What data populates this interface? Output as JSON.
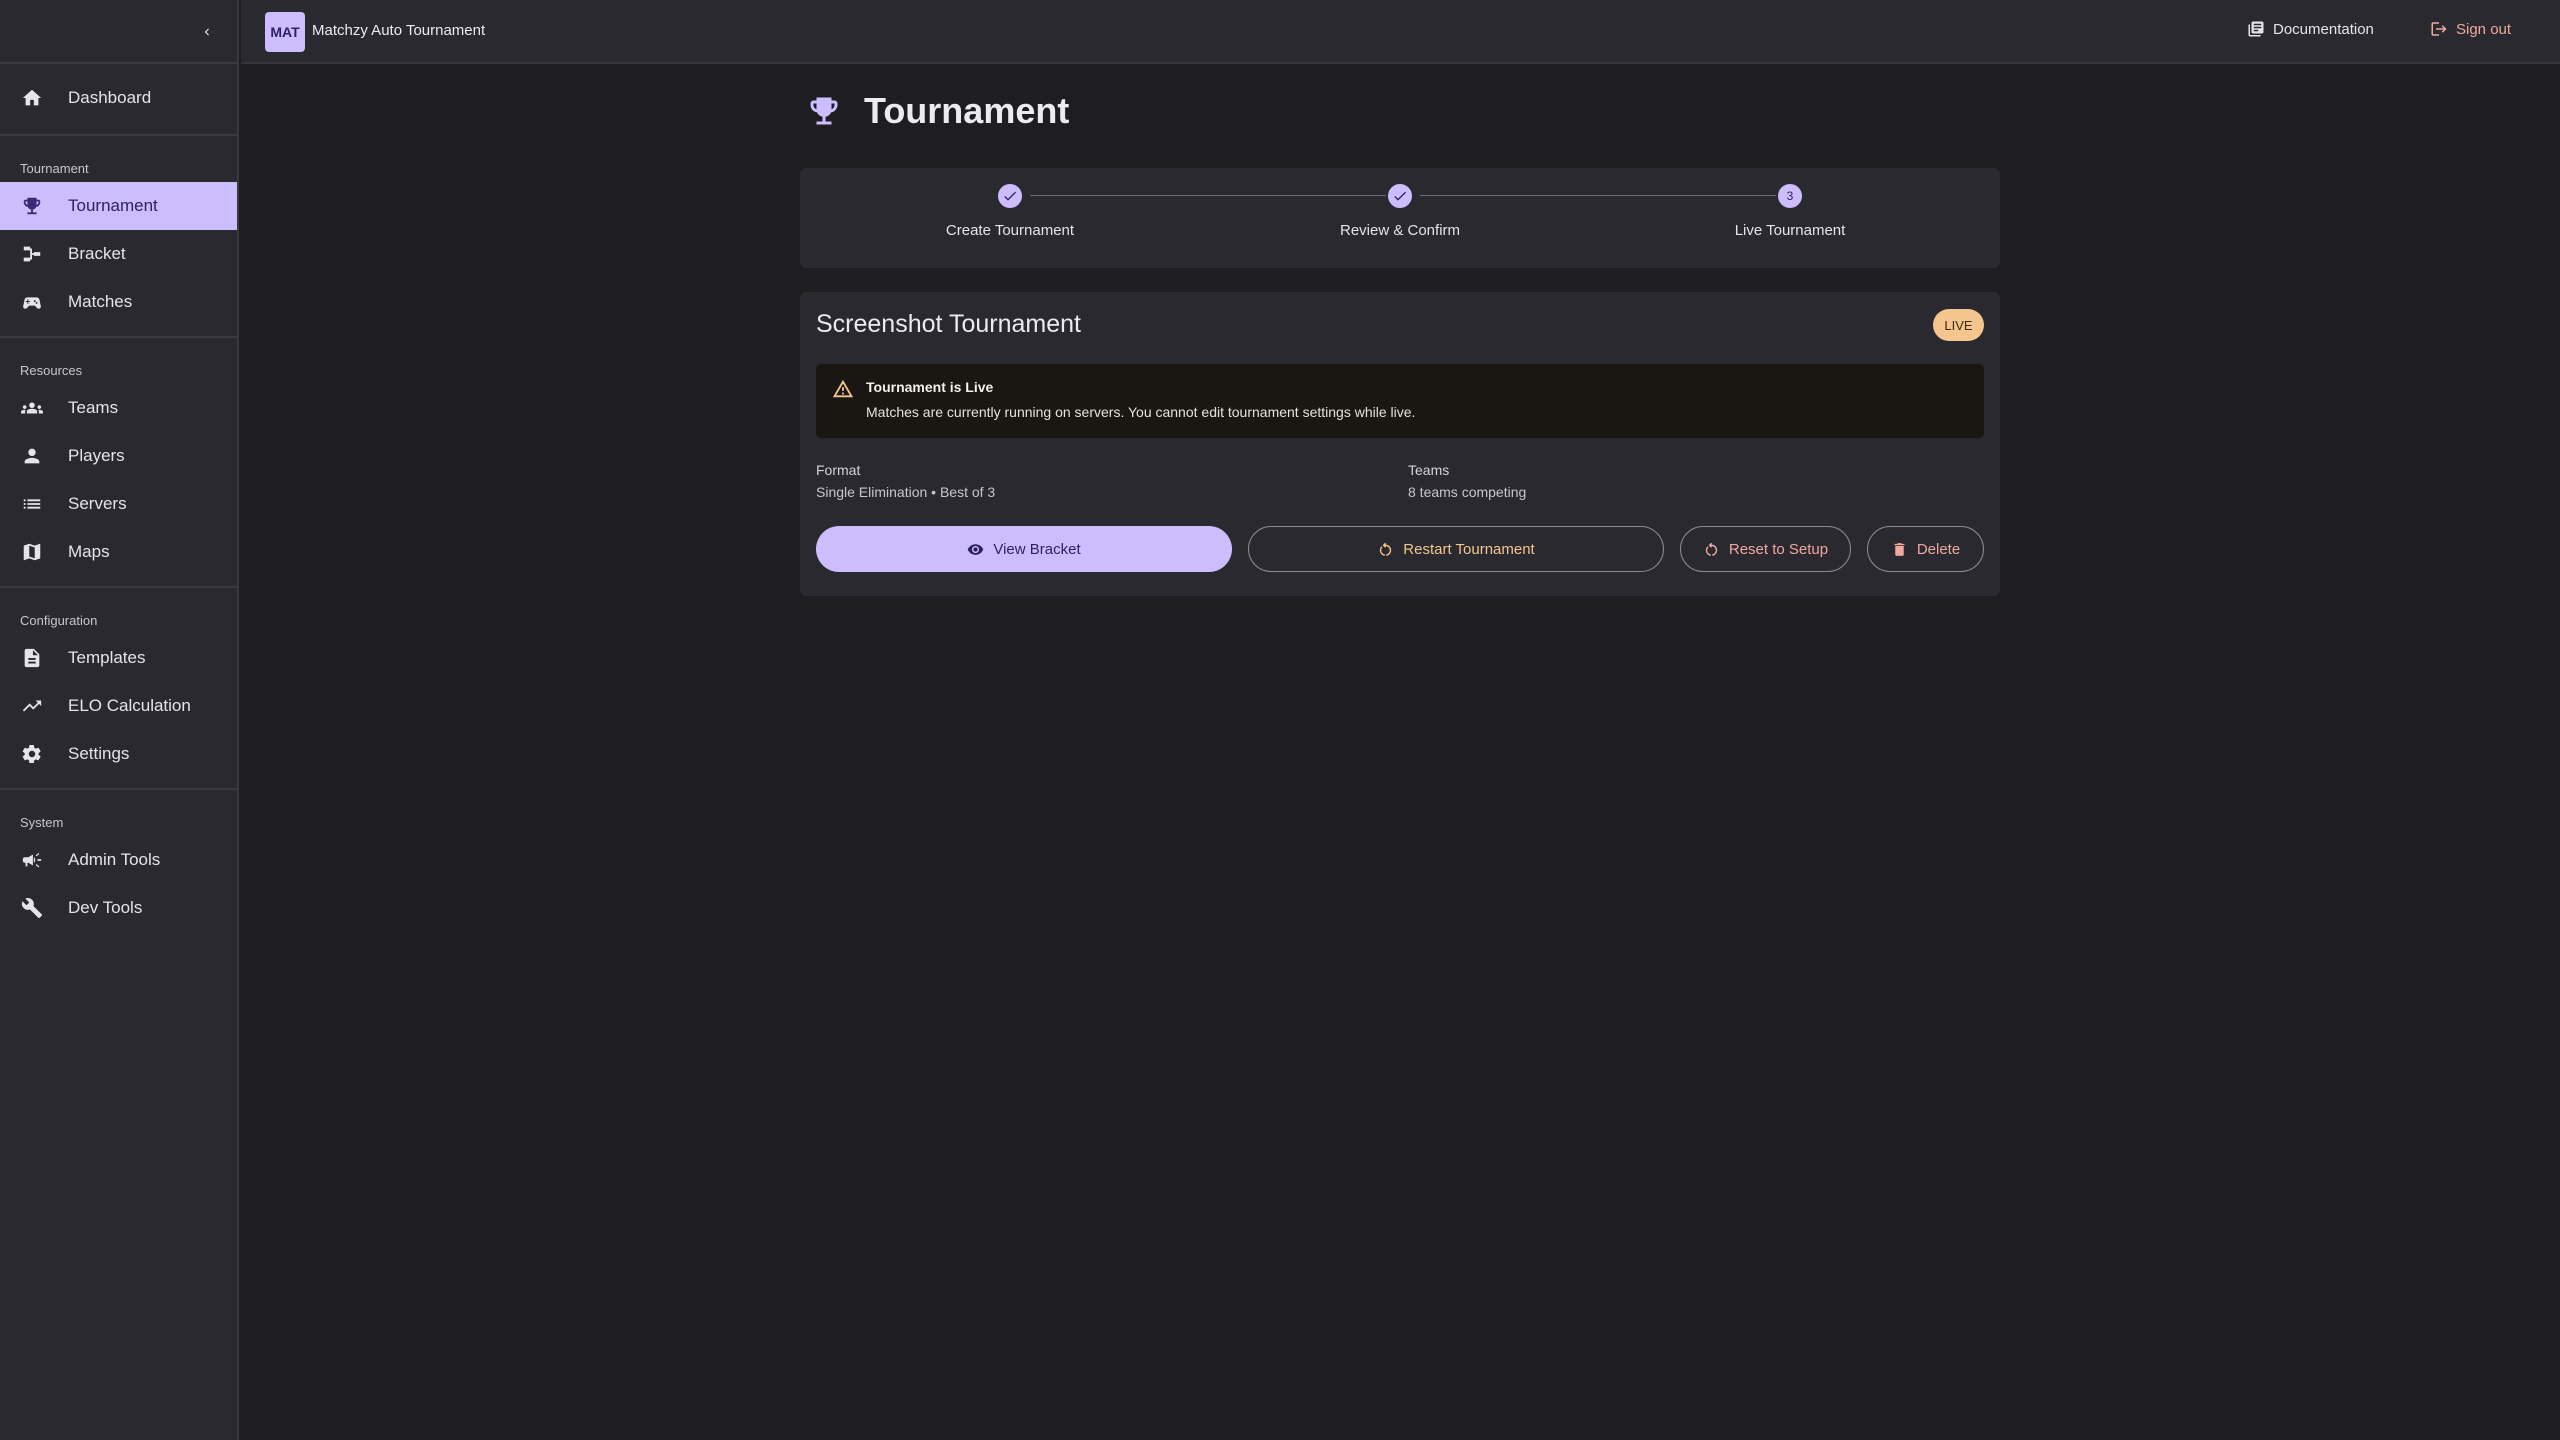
{
  "header": {
    "logo": "MAT",
    "app_title": "Matchzy Auto Tournament",
    "documentation": "Documentation",
    "sign_out": "Sign out"
  },
  "sidebar": {
    "top_items": [
      {
        "label": "Dashboard",
        "icon": "home-icon"
      }
    ],
    "sections": [
      {
        "heading": "Tournament",
        "items": [
          {
            "label": "Tournament",
            "icon": "trophy-icon",
            "active": true
          },
          {
            "label": "Bracket",
            "icon": "bracket-icon"
          },
          {
            "label": "Matches",
            "icon": "gamepad-icon"
          }
        ]
      },
      {
        "heading": "Resources",
        "items": [
          {
            "label": "Teams",
            "icon": "groups-icon"
          },
          {
            "label": "Players",
            "icon": "person-icon"
          },
          {
            "label": "Servers",
            "icon": "list-icon"
          },
          {
            "label": "Maps",
            "icon": "map-icon"
          }
        ]
      },
      {
        "heading": "Configuration",
        "items": [
          {
            "label": "Templates",
            "icon": "document-icon"
          },
          {
            "label": "ELO Calculation",
            "icon": "trending-up-icon"
          },
          {
            "label": "Settings",
            "icon": "gear-icon"
          }
        ]
      },
      {
        "heading": "System",
        "items": [
          {
            "label": "Admin Tools",
            "icon": "megaphone-icon"
          },
          {
            "label": "Dev Tools",
            "icon": "wrench-icon"
          }
        ]
      }
    ]
  },
  "main": {
    "page_title": "Tournament",
    "stepper": {
      "steps": [
        {
          "label": "Create Tournament",
          "state": "complete"
        },
        {
          "label": "Review & Confirm",
          "state": "complete"
        },
        {
          "label": "Live Tournament",
          "state": "active",
          "number": "3"
        }
      ]
    },
    "card": {
      "title": "Screenshot Tournament",
      "badge": "LIVE",
      "alert": {
        "title": "Tournament is Live",
        "body": "Matches are currently running on servers. You cannot edit tournament settings while live."
      },
      "format_label": "Format",
      "format_value": "Single Elimination • Best of 3",
      "teams_label": "Teams",
      "teams_value": "8 teams competing",
      "buttons": {
        "view_bracket": "View Bracket",
        "restart": "Restart Tournament",
        "reset": "Reset to Setup",
        "delete": "Delete"
      }
    }
  },
  "colors": {
    "accent": "#cdbdff",
    "warning": "#f4c58c",
    "danger": "#f0a9a0",
    "background": "#1e1d22",
    "surface": "#2a292f"
  }
}
